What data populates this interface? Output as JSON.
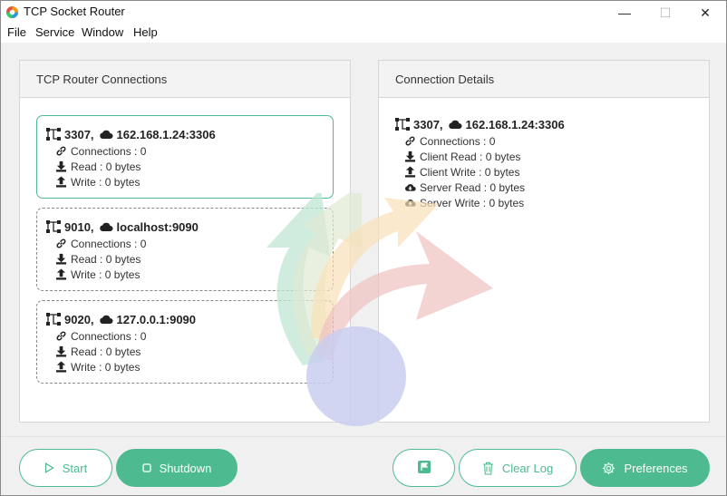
{
  "window": {
    "title": "TCP Socket Router",
    "minimize_glyph": "—",
    "maximize_glyph": "☐",
    "close_glyph": "✕"
  },
  "menu": [
    "File",
    "Service",
    "Window",
    "Help"
  ],
  "left_panel": {
    "title": "TCP Router Connections",
    "cards": [
      {
        "port": "3307,",
        "target": "162.168.1.24:3306",
        "connections": "Connections : 0",
        "read": "Read : 0 bytes",
        "write": "Write : 0 bytes",
        "active": true
      },
      {
        "port": "9010,",
        "target": "localhost:9090",
        "connections": "Connections : 0",
        "read": "Read : 0 bytes",
        "write": "Write : 0 bytes",
        "active": false
      },
      {
        "port": "9020,",
        "target": "127.0.0.1:9090",
        "connections": "Connections : 0",
        "read": "Read : 0 bytes",
        "write": "Write : 0 bytes",
        "active": false
      }
    ]
  },
  "right_panel": {
    "title": "Connection Details",
    "port": "3307,",
    "target": "162.168.1.24:3306",
    "connections": "Connections : 0",
    "client_read": "Client Read : 0 bytes",
    "client_write": "Client Write : 0 bytes",
    "server_read": "Server Read : 0 bytes",
    "server_write": "Server Write : 0 bytes"
  },
  "footer": {
    "start_label": "Start",
    "shutdown_label": "Shutdown",
    "flag_label": "",
    "clear_log_label": "Clear Log",
    "preferences_label": "Preferences"
  },
  "icons": {
    "route": "sitemap-icon",
    "cloud": "cloud-icon",
    "link": "link-icon",
    "download": "download-icon",
    "upload": "upload-icon",
    "cloud_download": "cloud-download-icon",
    "cloud_upload": "cloud-upload-icon",
    "play": "play-icon",
    "stop": "stop-icon",
    "flag": "flag-icon",
    "trash": "trash-icon",
    "gear": "gear-icon"
  },
  "colors": {
    "accent": "#4dbb8f",
    "panel_header": "#f3f3f3",
    "background": "#f0f0f0"
  }
}
